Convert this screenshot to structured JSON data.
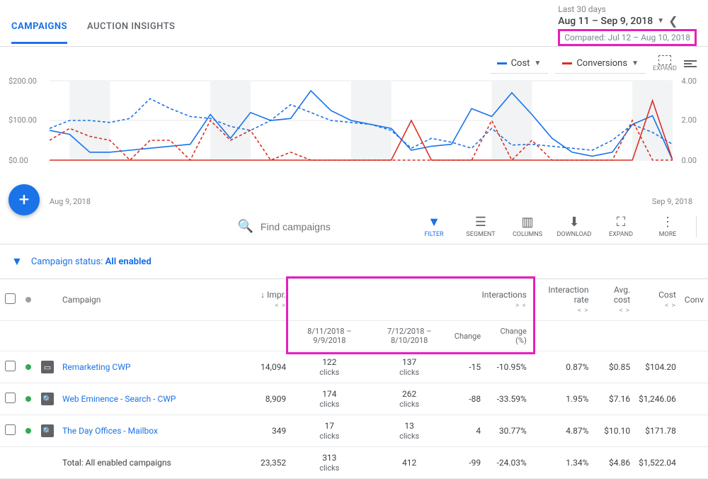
{
  "header": {
    "tabs": {
      "campaigns": "CAMPAIGNS",
      "auction": "AUCTION INSIGHTS"
    },
    "date_label": "Last 30 days",
    "date_range": "Aug 11 – Sep 9, 2018",
    "compare_label": "Compared: Jul 12 – Aug 10, 2018"
  },
  "chart_controls": {
    "metric1": "Cost",
    "metric2": "Conversions",
    "expand": "EXPAND"
  },
  "chart_data": {
    "type": "line",
    "title": "",
    "xlabel": "",
    "ylabel_left": "Cost ($)",
    "ylabel_right": "Conversions",
    "ylim_left": [
      0,
      200
    ],
    "ylim_right": [
      0,
      4
    ],
    "x_start": "Aug 9, 2018",
    "x_end": "Sep 9, 2018",
    "y_ticks_left": [
      "$0.00",
      "$100.00",
      "$200.00"
    ],
    "y_ticks_right": [
      "0.00",
      "2.00",
      "4.00"
    ],
    "series": [
      {
        "name": "Cost (current)",
        "color": "#1a73e8",
        "style": "solid",
        "values": [
          75,
          65,
          20,
          20,
          25,
          30,
          35,
          40,
          115,
          55,
          120,
          100,
          105,
          175,
          125,
          100,
          90,
          80,
          25,
          35,
          40,
          130,
          110,
          170,
          115,
          55,
          20,
          10,
          20,
          90,
          112,
          0
        ]
      },
      {
        "name": "Cost (previous)",
        "color": "#1a73e8",
        "style": "dashed",
        "values": [
          80,
          100,
          100,
          95,
          105,
          155,
          130,
          110,
          105,
          85,
          75,
          100,
          140,
          120,
          100,
          95,
          90,
          75,
          30,
          55,
          45,
          30,
          80,
          38,
          40,
          35,
          30,
          25,
          50,
          90,
          70,
          40
        ]
      },
      {
        "name": "Conversions (current)",
        "color": "#d93025",
        "style": "solid",
        "values": [
          0,
          0,
          0,
          0,
          0,
          0,
          0,
          0,
          0,
          0,
          0,
          0,
          0,
          0,
          0,
          0,
          0,
          0,
          2,
          0,
          0,
          0,
          0,
          0,
          0,
          0,
          0,
          0,
          0,
          0,
          3,
          0
        ]
      },
      {
        "name": "Conversions (previous)",
        "color": "#d93025",
        "style": "dashed",
        "values": [
          1,
          1.6,
          1.2,
          1,
          0,
          1,
          1,
          0,
          2,
          1,
          1.5,
          0,
          0.4,
          0,
          0,
          0,
          0,
          0,
          0,
          0,
          0,
          0,
          2,
          0,
          1,
          0,
          0,
          0,
          0,
          2,
          0,
          0
        ]
      }
    ]
  },
  "toolbar": {
    "search_placeholder": "Find campaigns",
    "filter": "FILTER",
    "segment": "SEGMENT",
    "columns": "COLUMNS",
    "download": "DOWNLOAD",
    "expand": "EXPAND",
    "more": "MORE"
  },
  "filter": {
    "label": "Campaign status: ",
    "value": "All enabled"
  },
  "table": {
    "headers": {
      "campaign": "Campaign",
      "impr": "Impr.",
      "interactions": "Interactions",
      "interaction_rate": "Interaction rate",
      "avg_cost": "Avg. cost",
      "cost": "Cost",
      "conv": "Conv"
    },
    "subheaders": {
      "period1": "8/11/2018 – 9/9/2018",
      "period2": "7/12/2018 – 8/10/2018",
      "change": "Change",
      "change_pct": "Change (%)"
    },
    "rows": [
      {
        "name": "Remarketing CWP",
        "type": "display",
        "impr": "14,094",
        "p1": "122 clicks",
        "p2": "137 clicks",
        "change": "-15",
        "change_pct": "-10.95%",
        "rate": "0.87%",
        "avg_cost": "$0.85",
        "cost": "$104.20"
      },
      {
        "name": "Web Eminence - Search - CWP",
        "type": "search",
        "impr": "8,909",
        "p1": "174 clicks",
        "p2": "262 clicks",
        "change": "-88",
        "change_pct": "-33.59%",
        "rate": "1.95%",
        "avg_cost": "$7.16",
        "cost": "$1,246.06"
      },
      {
        "name": "The Day Offices - Mailbox",
        "type": "search",
        "impr": "349",
        "p1": "17 clicks",
        "p2": "13 clicks",
        "change": "4",
        "change_pct": "30.77%",
        "rate": "4.87%",
        "avg_cost": "$10.10",
        "cost": "$171.78"
      }
    ],
    "totals": {
      "label": "Total: All enabled campaigns",
      "impr": "23,352",
      "p1": "313 clicks",
      "p2": "412",
      "change": "-99",
      "change_pct": "-24.03%",
      "rate": "1.34%",
      "avg_cost": "$4.86",
      "cost": "$1,522.04"
    }
  },
  "icons": {
    "search_name": "🔍"
  }
}
